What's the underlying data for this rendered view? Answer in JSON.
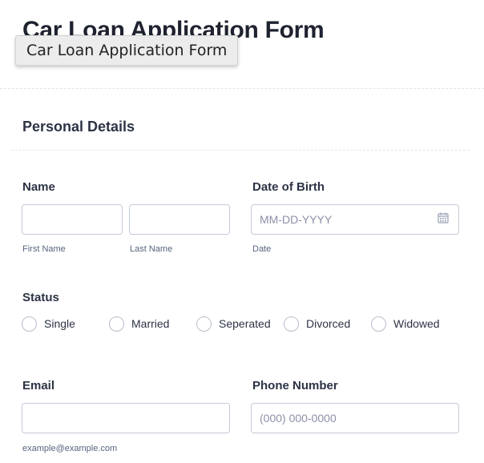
{
  "form": {
    "title": "Car Loan Application Form",
    "tooltip": "Car Loan Application Form"
  },
  "section": {
    "title": "Personal Details"
  },
  "name": {
    "label": "Name",
    "first_sublabel": "First Name",
    "last_sublabel": "Last Name",
    "first_value": "",
    "last_value": ""
  },
  "dob": {
    "label": "Date of Birth",
    "placeholder": "MM-DD-YYYY",
    "sublabel": "Date",
    "icon": "calendar-icon"
  },
  "status": {
    "label": "Status",
    "options": [
      "Single",
      "Married",
      "Seperated",
      "Divorced",
      "Widowed"
    ]
  },
  "email": {
    "label": "Email",
    "sublabel": "example@example.com",
    "value": ""
  },
  "phone": {
    "label": "Phone Number",
    "placeholder": "(000) 000-0000"
  },
  "colors": {
    "text": "#2c3345",
    "border": "#c3cad8",
    "sublabel": "#57647e",
    "placeholder": "#8d8fa8"
  }
}
